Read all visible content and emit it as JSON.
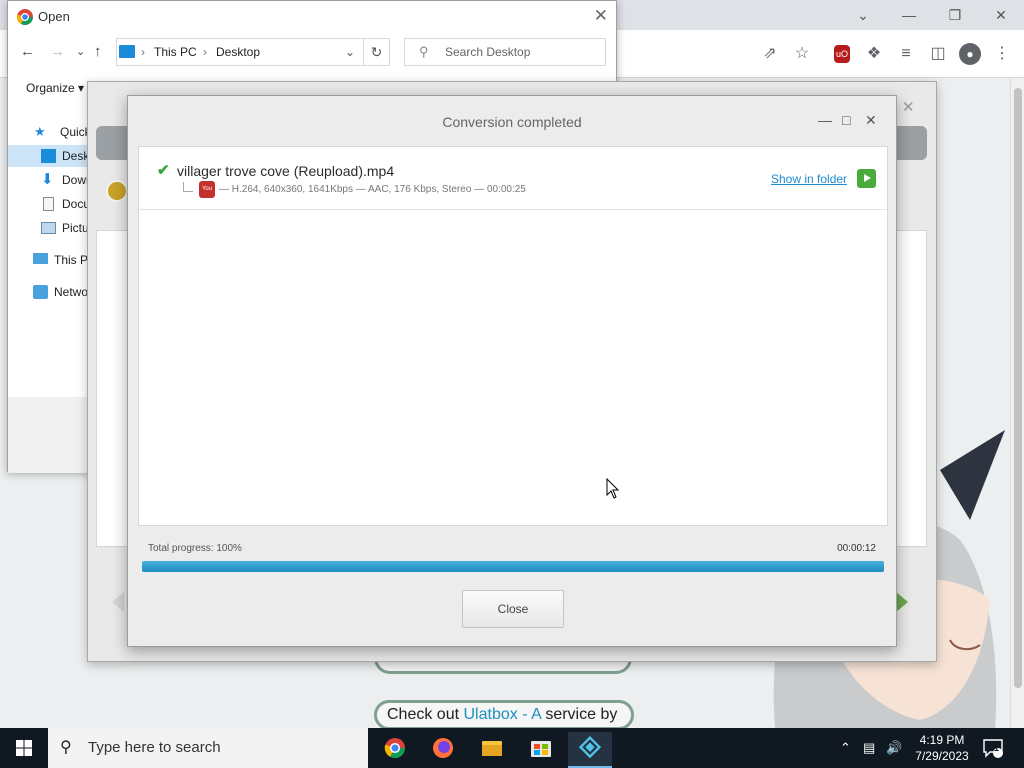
{
  "explorer": {
    "title": "Open",
    "address": {
      "seg1": "This PC",
      "seg2": "Desktop"
    },
    "search_placeholder": "Search Desktop",
    "organize_label": "Organize",
    "tree": [
      {
        "label": "Quick",
        "icon": "star-icon"
      },
      {
        "label": "Desk",
        "icon": "desktop-folder-icon"
      },
      {
        "label": "Dowr",
        "icon": "downloads-icon"
      },
      {
        "label": "Docu",
        "icon": "documents-icon"
      },
      {
        "label": "Pictu",
        "icon": "pictures-icon"
      },
      {
        "label": "This PC",
        "icon": "this-pc-icon"
      },
      {
        "label": "Netwo",
        "icon": "network-icon"
      }
    ]
  },
  "browser": {
    "page_link_text": "Check out",
    "page_link_anchor": "Ulatbox - A",
    "page_link_suffix": "service by"
  },
  "conversion": {
    "title": "Conversion completed",
    "file": {
      "name": "villager trove cove (Reupload).mp4",
      "details": "— H.264, 640x360, 1641Kbps — AAC, 176 Kbps, Stereo — 00:00:25",
      "show_in_folder": "Show in folder"
    },
    "progress_label": "Total progress: 100%",
    "progress_value": 1.0,
    "elapsed": "00:00:12",
    "close_label": "Close"
  },
  "taskbar": {
    "search_placeholder": "Type here to search",
    "time": "4:19 PM",
    "date": "7/29/2023",
    "notification_count": "1"
  },
  "colors": {
    "progress": "#2ea0d2",
    "accent_link": "#1f8ad0",
    "success": "#3aa33a",
    "taskbar": "#101821"
  }
}
